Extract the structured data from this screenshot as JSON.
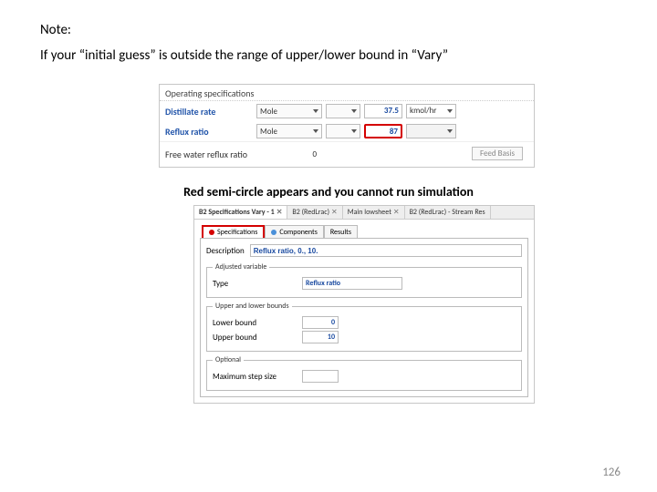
{
  "note": {
    "heading": "Note:",
    "text": "If your “initial guess” is outside the range of upper/lower bound in “Vary”"
  },
  "panel1": {
    "group": "Operating specifications",
    "rows": {
      "distillate": {
        "label": "Distillate rate",
        "basis": "Mole",
        "value": "37.5",
        "unit": "kmol/hr"
      },
      "reflux": {
        "label": "Reflux ratio",
        "basis": "Mole",
        "value": "87"
      }
    },
    "free": {
      "label": "Free water reflux ratio",
      "value": "0"
    },
    "feed_basis": "Feed Basis"
  },
  "caption": "Red semi-circle appears and you cannot run simulation",
  "panel2": {
    "tabs": [
      "B2 Specifications Vary - 1",
      "B2 (RedLrac)",
      "Main  lowsheet",
      "B2 (RedLrac) - Stream Res"
    ],
    "inner_tabs": {
      "spec": "Specifications",
      "components": "Components",
      "results": "Results"
    },
    "description_label": "Description",
    "description_value": "Reflux ratio, 0., 10.",
    "adjusted": {
      "legend": "Adjusted variable",
      "type_label": "Type",
      "type_value": "Reflux ratio"
    },
    "bounds": {
      "legend": "Upper and lower bounds",
      "lower_label": "Lower bound",
      "lower": "0",
      "upper_label": "Upper bound",
      "upper": "10"
    },
    "optional": {
      "legend": "Optional",
      "max_step_label": "Maximum step size"
    }
  },
  "page_number": "126"
}
